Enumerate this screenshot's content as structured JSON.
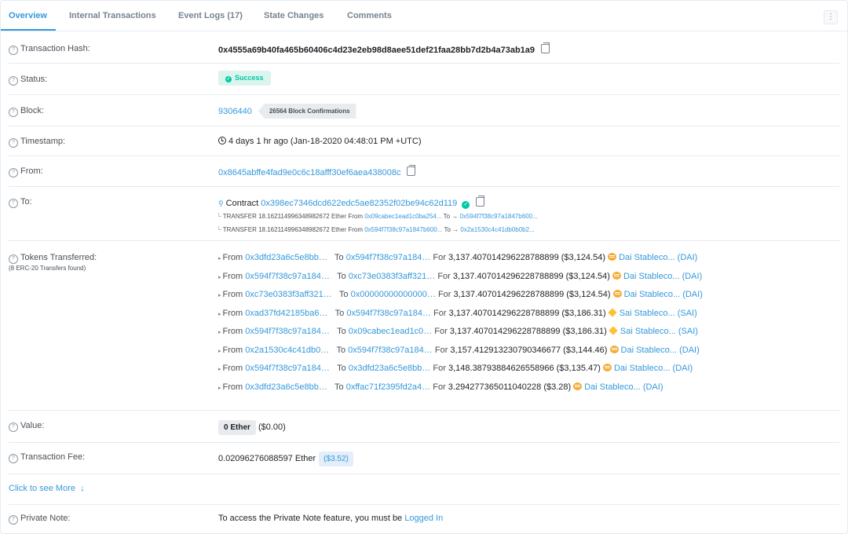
{
  "tabs": [
    {
      "label": "Overview"
    },
    {
      "label": "Internal Transactions"
    },
    {
      "label": "Event Logs (17)"
    },
    {
      "label": "State Changes"
    },
    {
      "label": "Comments"
    }
  ],
  "menu_glyph": "⋮",
  "tx_hash": {
    "label": "Transaction Hash:",
    "value": "0x4555a69b40fa465b60406c4d23e2eb98d8aee51def21faa28bb7d2b4a73ab1a9"
  },
  "status": {
    "label": "Status:",
    "value": "Success"
  },
  "block": {
    "label": "Block:",
    "number": "9306440",
    "confirmations": "26564 Block Confirmations"
  },
  "timestamp": {
    "label": "Timestamp:",
    "value": "4 days 1 hr ago (Jan-18-2020 04:48:01 PM +UTC)"
  },
  "from": {
    "label": "From:",
    "value": "0x8645abffe4fad9e0c6c18afff30ef6aea438008c"
  },
  "to": {
    "label": "To:",
    "prefix": "Contract",
    "address": "0x398ec7346dcd622edc5ae82352f02be94c62d119",
    "internal": [
      {
        "kind": "TRANSFER",
        "amount": "18.162114996348982672 Ether",
        "from_word": "From",
        "from": "0x09cabec1ead1c0ba254...",
        "to_word": "To",
        "to": "0x594f7f38c97a1847b600..."
      },
      {
        "kind": "TRANSFER",
        "amount": "18.162114996348982672 Ether",
        "from_word": "From",
        "from": "0x594f7f38c97a1847b600...",
        "to_word": "To",
        "to": "0x2a1530c4c41db0b0b2..."
      }
    ]
  },
  "tokens": {
    "label": "Tokens Transferred:",
    "sublabel": "(8 ERC-20 Transfers found)",
    "transfers": [
      {
        "from": "0x3dfd23a6c5e8bb…",
        "to": "0x594f7f38c97a184…",
        "amount": "3,137.407014296228788899 ($3,124.54)",
        "token": "Dai Stableco... (DAI)",
        "icon": "dai"
      },
      {
        "from": "0x594f7f38c97a184…",
        "to": "0xc73e0383f3aff321…",
        "amount": "3,137.407014296228788899 ($3,124.54)",
        "token": "Dai Stableco... (DAI)",
        "icon": "dai"
      },
      {
        "from": "0xc73e0383f3aff321…",
        "to": "0x00000000000000…",
        "amount": "3,137.407014296228788899 ($3,124.54)",
        "token": "Dai Stableco... (DAI)",
        "icon": "dai"
      },
      {
        "from": "0xad37fd42185ba6…",
        "to": "0x594f7f38c97a184…",
        "amount": "3,137.407014296228788899 ($3,186.31)",
        "token": "Sai Stableco... (SAI)",
        "icon": "sai"
      },
      {
        "from": "0x594f7f38c97a184…",
        "to": "0x09cabec1ead1c0…",
        "amount": "3,137.407014296228788899 ($3,186.31)",
        "token": "Sai Stableco... (SAI)",
        "icon": "sai"
      },
      {
        "from": "0x2a1530c4c41db0…",
        "to": "0x594f7f38c97a184…",
        "amount": "3,157.412913230790346677 ($3,144.46)",
        "token": "Dai Stableco... (DAI)",
        "icon": "dai"
      },
      {
        "from": "0x594f7f38c97a184…",
        "to": "0x3dfd23a6c5e8bb…",
        "amount": "3,148.38793884626558966 ($3,135.47)",
        "token": "Dai Stableco... (DAI)",
        "icon": "dai"
      },
      {
        "from": "0x3dfd23a6c5e8bb…",
        "to": "0xffac71f2395fd2a4…",
        "amount": "3.294277365011040228 ($3.28)",
        "token": "Dai Stableco... (DAI)",
        "icon": "dai"
      }
    ],
    "from_word": "From",
    "to_word": "To",
    "for_word": "For"
  },
  "value": {
    "label": "Value:",
    "ether": "0 Ether",
    "usd": "($0.00)"
  },
  "fee": {
    "label": "Transaction Fee:",
    "value": "0.02096276088597 Ether",
    "usd": "($3.52)"
  },
  "more": {
    "label": "Click to see More",
    "arrow": "↓"
  },
  "note": {
    "label": "Private Note:",
    "text": "To access the Private Note feature, you must be",
    "link": "Logged In"
  },
  "colors": {
    "accent": "#3498db",
    "success": "#00c9a7",
    "border": "#e7eaf3",
    "dai": "#f5ac37",
    "sai": "#fdc134"
  },
  "icons": [
    "question-icon",
    "copy-icon",
    "check-circle-icon",
    "clock-icon",
    "contract-search-icon",
    "verified-icon",
    "dai-token-icon",
    "sai-token-icon",
    "arrow-down-icon",
    "kebab-menu-icon"
  ]
}
